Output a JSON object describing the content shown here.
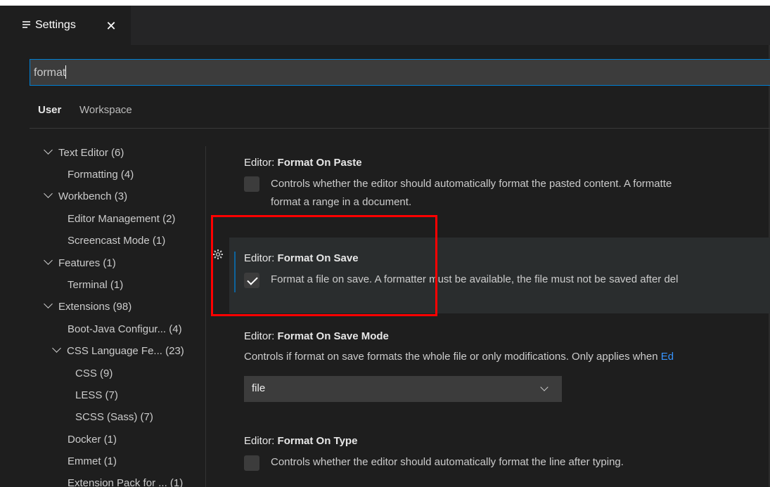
{
  "tab": {
    "label": "Settings",
    "icon": "settings-editor-icon",
    "close": "✕"
  },
  "search": {
    "value": "format"
  },
  "scope_tabs": {
    "user": "User",
    "workspace": "Workspace"
  },
  "toc": [
    {
      "label": "Text Editor",
      "count": "(6)",
      "expanded": true
    },
    {
      "label": "Formatting",
      "count": "(4)"
    },
    {
      "label": "Workbench",
      "count": "(3)",
      "expanded": true
    },
    {
      "label": "Editor Management",
      "count": "(2)"
    },
    {
      "label": "Screencast Mode",
      "count": "(1)"
    },
    {
      "label": "Features",
      "count": "(1)",
      "expanded": true
    },
    {
      "label": "Terminal",
      "count": "(1)"
    },
    {
      "label": "Extensions",
      "count": "(98)",
      "expanded": true
    },
    {
      "label": "Boot-Java Configur...",
      "count": "(4)"
    },
    {
      "label": "CSS Language Fe...",
      "count": "(23)",
      "expanded": true
    },
    {
      "label": "CSS",
      "count": "(9)"
    },
    {
      "label": "LESS",
      "count": "(7)"
    },
    {
      "label": "SCSS (Sass)",
      "count": "(7)"
    },
    {
      "label": "Docker",
      "count": "(1)"
    },
    {
      "label": "Emmet",
      "count": "(1)"
    },
    {
      "label": "Extension Pack for ...",
      "count": "(1)"
    }
  ],
  "settings": {
    "paste": {
      "category": "Editor: ",
      "name": "Format On Paste",
      "desc1": "Controls whether the editor should automatically format the pasted content. A formatte",
      "desc2": "format a range in a document.",
      "checked": false
    },
    "save": {
      "category": "Editor: ",
      "name": "Format On Save",
      "desc": "Format a file on save. A formatter must be available, the file must not be saved after del",
      "checked": true
    },
    "save_mode": {
      "category": "Editor: ",
      "name": "Format On Save Mode",
      "desc": "Controls if format on save formats the whole file or only modifications. Only applies when ",
      "desc_link": "Ed",
      "value": "file"
    },
    "type": {
      "category": "Editor: ",
      "name": "Format On Type",
      "desc": "Controls whether the editor should automatically format the line after typing.",
      "checked": false
    }
  },
  "colors": {
    "background": "#1e1e1e",
    "accent": "#007fd4",
    "annotation": "#ff0000",
    "link": "#3794ff"
  }
}
